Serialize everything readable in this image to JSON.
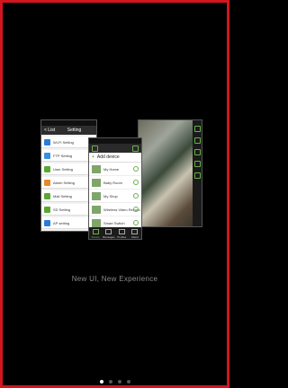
{
  "tagline": "New UI, New Experience",
  "settings_phone": {
    "back": "< List",
    "title": "Setting",
    "items": [
      "Wi-Fi Setting",
      "FTP Setting",
      "User Setting",
      "Alarm Setting",
      "Mail Setting",
      "SD Setting",
      "AP setting"
    ]
  },
  "center_phone": {
    "add_device": "Add device",
    "devices": [
      "My Home",
      "Baby Room",
      "My Shop",
      "Wireless Video Record",
      "Smart Switch"
    ],
    "tabs": [
      "Device",
      "Messages",
      "Profiles",
      "About"
    ]
  },
  "pager": {
    "count": 4,
    "active_index": 0
  },
  "colors": {
    "border": "#d3151f",
    "accent": "#6ab04c",
    "background": "#000000"
  }
}
